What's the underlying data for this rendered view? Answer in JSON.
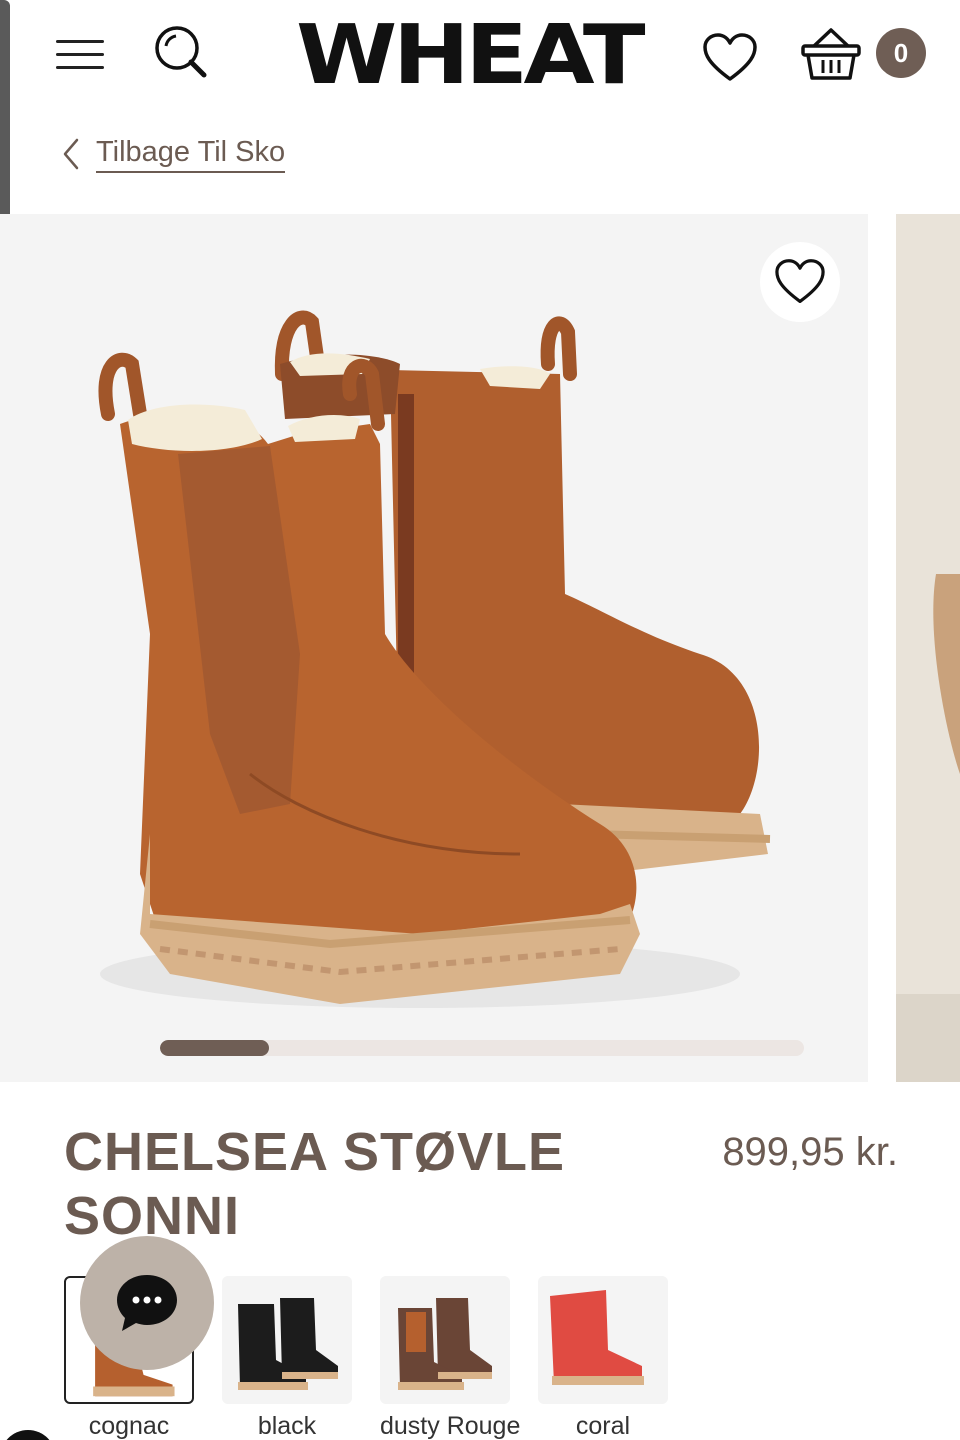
{
  "header": {
    "logo": "WHEAT",
    "cart_count": "0",
    "icons": [
      "menu-icon",
      "search-icon",
      "heart-icon",
      "basket-icon"
    ]
  },
  "back_link": {
    "label": "Tilbage Til Sko",
    "icon": "chevron-left-icon"
  },
  "gallery": {
    "image_description": "cognac leather chelsea boots with shearling lining",
    "slide_progress": 0.17,
    "favorite_icon": "heart-icon"
  },
  "product": {
    "title": "CHELSEA STØVLE SONNI",
    "price": "899,95 kr."
  },
  "variants": [
    {
      "label": "cognac",
      "selected": true,
      "color": "#b5602e"
    },
    {
      "label": "black",
      "selected": false,
      "color": "#1c1c1c"
    },
    {
      "label": "dusty Rouge",
      "selected": false,
      "color": "#6a4536"
    },
    {
      "label": "coral",
      "selected": false,
      "color": "#e04b42"
    }
  ],
  "chat": {
    "icon": "chat-bubble-icon"
  },
  "colors": {
    "brand": "#6f5e55",
    "text": "#6b5b52",
    "image_bg": "#f4f4f4"
  }
}
